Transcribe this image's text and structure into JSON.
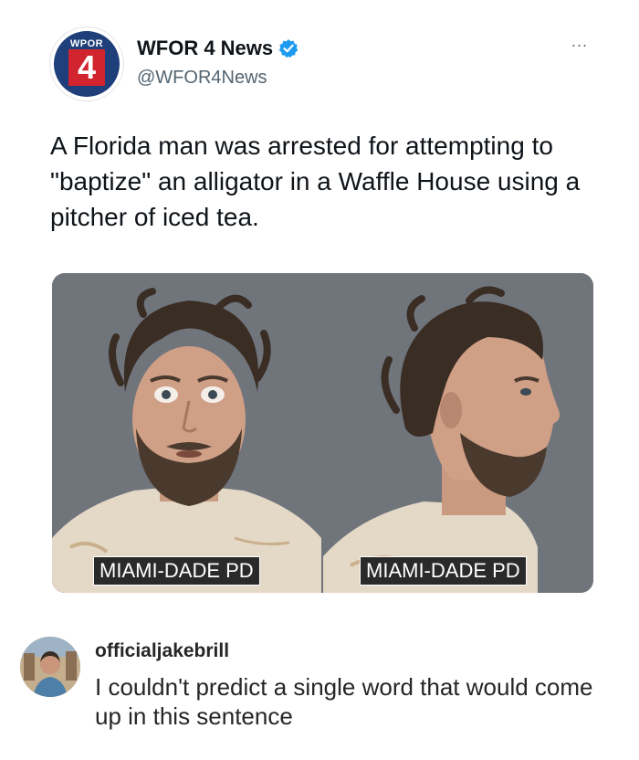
{
  "tweet": {
    "logo": {
      "text": "WPOR",
      "number": "4",
      "colors": {
        "blue": "#1f3f7a",
        "red": "#d1242f"
      }
    },
    "account_name": "WFOR 4 News",
    "handle": "@WFOR4News",
    "verified_icon": "verified-badge-icon",
    "more_icon": "more-dots-icon",
    "more_label": "...",
    "text": "A Florida man was arrested for attempting to \"baptize\" an alligator in a Waffle House using a pitcher of iced tea.",
    "media": {
      "left_caption": "MIAMI-DADE PD",
      "right_caption": "MIAMI-DADE PD"
    }
  },
  "comment": {
    "username": "officialjakebrill",
    "text": "I couldn't predict a single word that would come up in this sentence"
  },
  "colors": {
    "verified": "#1d9bf0",
    "text": "#0f1419",
    "handle": "#536471"
  }
}
